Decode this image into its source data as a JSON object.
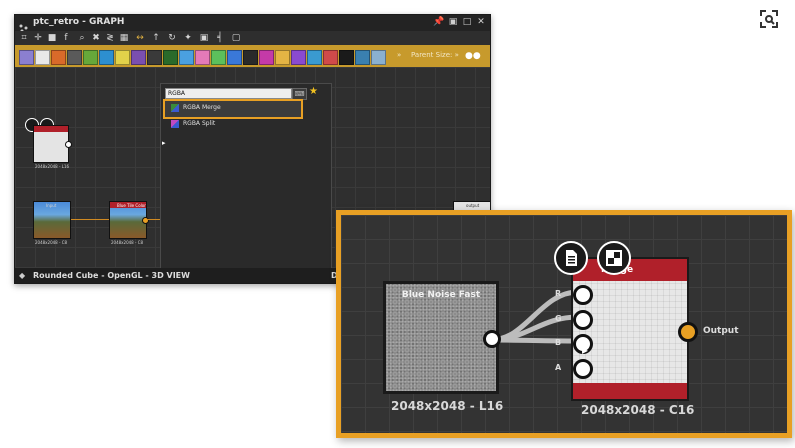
{
  "window": {
    "title": "ptc_retro - GRAPH",
    "parent_size_label": "Parent Size: »",
    "overflow_label": "»"
  },
  "search": {
    "value": "RGBA",
    "results": [
      {
        "label": "RGBA Merge"
      },
      {
        "label": "RGBA Split"
      }
    ]
  },
  "graph_nodes": {
    "uniform": {
      "size": "2048x2048 - L16"
    },
    "image_a": {
      "title": "Input",
      "size": "2048x2048 - C8"
    },
    "image_b": {
      "title": "Blue Tile Color",
      "size": "2048x2048 - C8"
    },
    "output_title": "output"
  },
  "bottom_panel": {
    "title": "Rounded Cube - OpenGL - 3D VIEW",
    "right_letter": "D"
  },
  "zoom": {
    "noise_title": "Blue Noise Fast",
    "noise_size": "2048x2048 - L16",
    "merge_title": "Merge",
    "merge_size": "2048x2048 - C16",
    "ports": [
      "R",
      "G",
      "B",
      "A"
    ],
    "output_label": "Output"
  },
  "colors": {
    "highlight": "#e8a024",
    "node_header": "#b0202a",
    "toolbar": "#c79a2c"
  },
  "icons": [
    "scan-screenshot-icon",
    "pin-icon",
    "float-icon",
    "maximize-icon",
    "close-icon",
    "star-icon",
    "document-icon",
    "checker-icon",
    "cube-icon"
  ]
}
